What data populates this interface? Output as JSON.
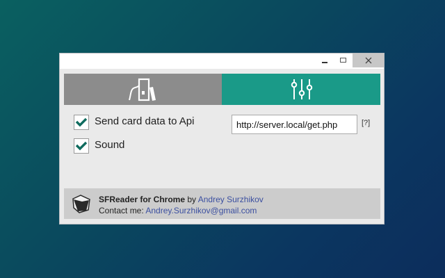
{
  "window": {
    "controls": {
      "minimize_icon": "minimize-icon",
      "maximize_icon": "maximize-icon",
      "close_icon": "close-icon"
    }
  },
  "tabs": [
    {
      "id": "device",
      "icon": "card-reader-icon",
      "active": false,
      "color": "#8c8c8c"
    },
    {
      "id": "settings",
      "icon": "sliders-icon",
      "active": true,
      "color": "#1a9a88"
    }
  ],
  "settings": {
    "send_card_data": {
      "label": "Send card data to Api",
      "checked": true
    },
    "sound": {
      "label": "Sound",
      "checked": true
    },
    "api_url": {
      "value": "http://server.local/get.php"
    },
    "help_label": "[?]"
  },
  "footer": {
    "app_name": "SFReader for Chrome",
    "by": "by",
    "author": "Andrey Surzhikov",
    "contact_label": "Contact me:",
    "email": "Andrey.Surzhikov@gmail.com",
    "logo_icon": "sfreader-logo-icon"
  },
  "colors": {
    "accent": "#1a9a88",
    "checkmark": "#0f6b5e",
    "link": "#3b4fa0"
  }
}
